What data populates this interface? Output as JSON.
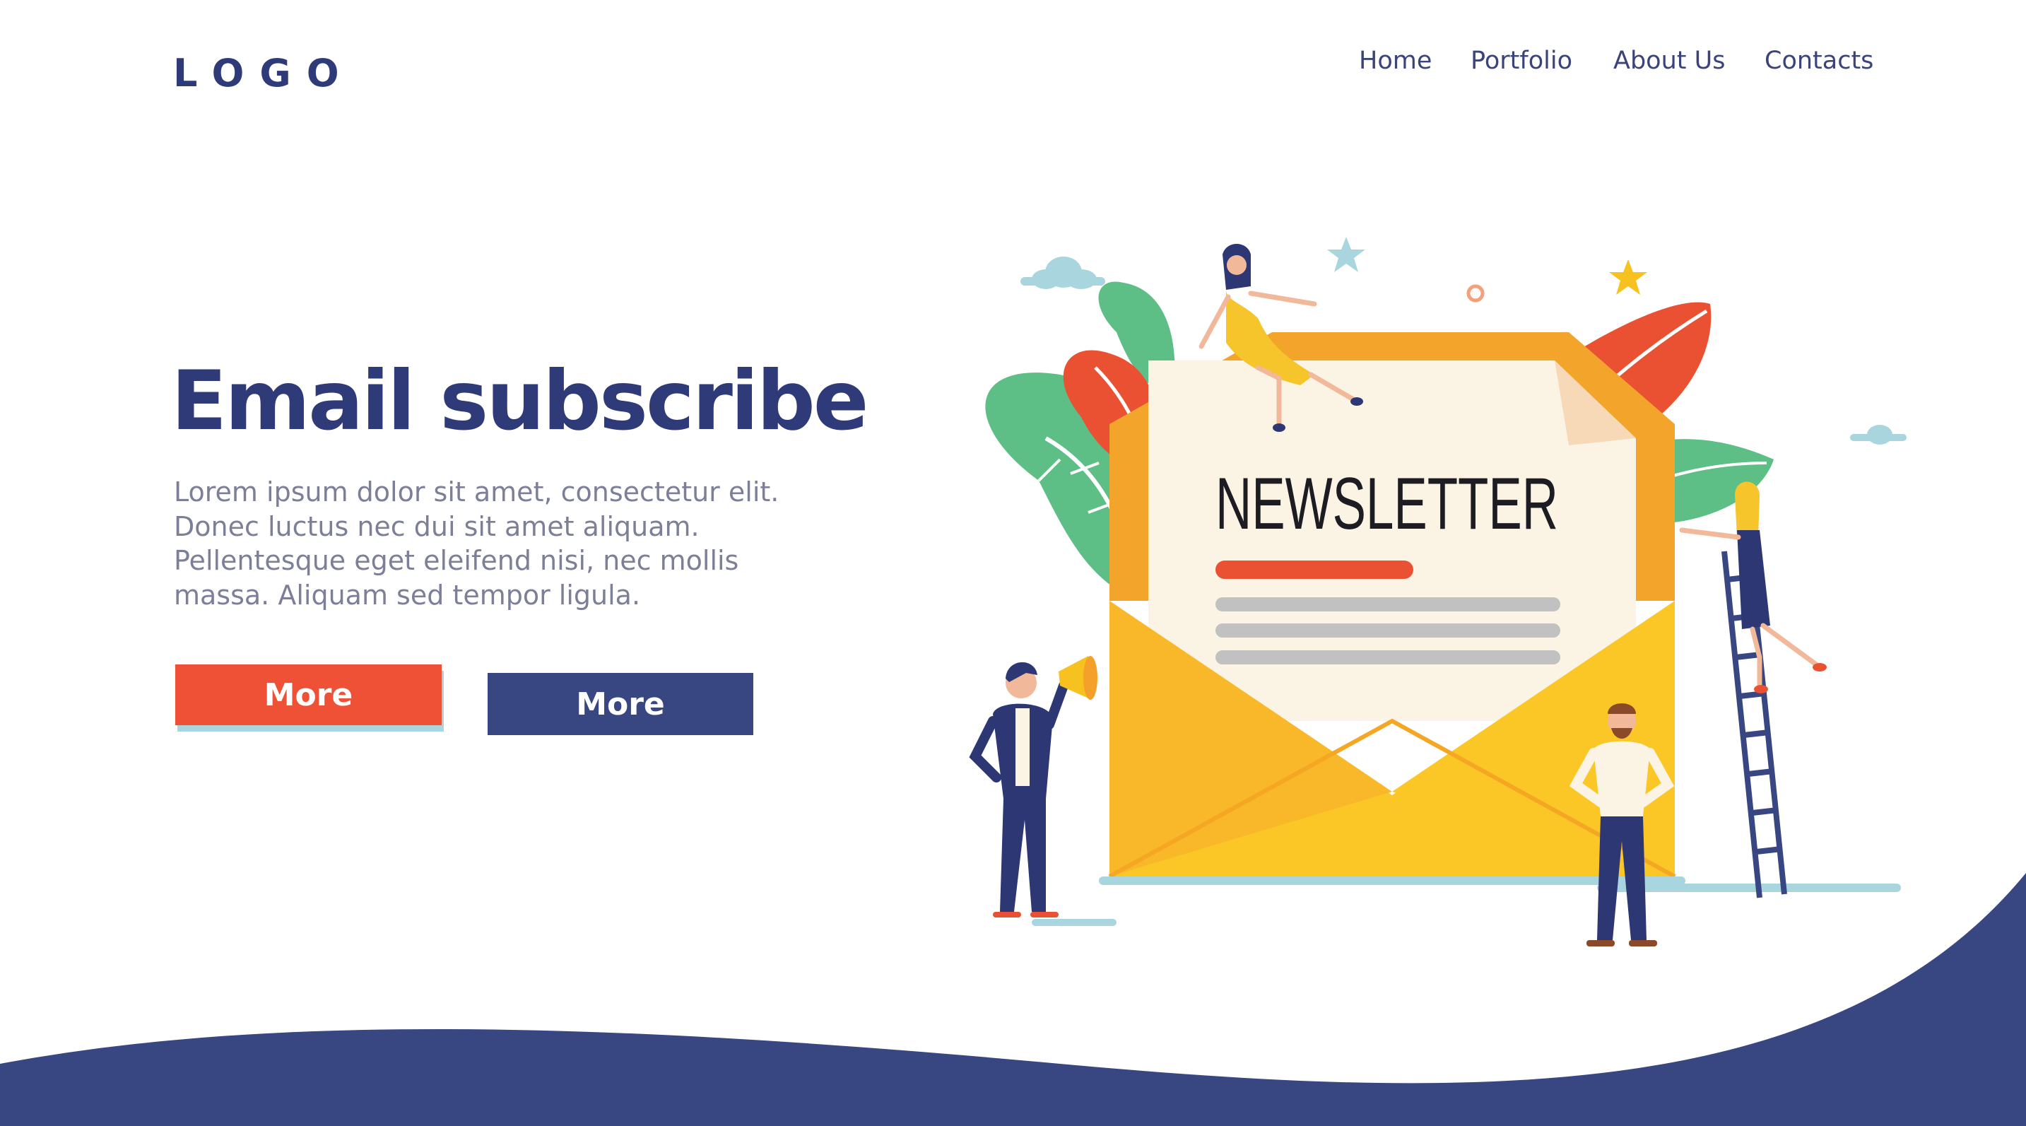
{
  "header": {
    "logo": "LOGO",
    "nav": [
      "Home",
      "Portfolio",
      "About Us",
      "Contacts"
    ]
  },
  "hero": {
    "title": "Email subscribe",
    "text": "Lorem ipsum dolor sit amet, consectetur elit. Donec luctus nec dui sit amet aliquam. Pellentesque eget eleifend nisi, nec mollis massa. Aliquam sed tempor ligula.",
    "buttons": [
      "More",
      "More"
    ]
  },
  "illustration": {
    "paper_heading": "NEWSLETTER"
  },
  "colors": {
    "navy": "#384682",
    "accent_red": "#ef5137",
    "envelope_yellow": "#fbc727",
    "leaf_green": "#5dbf86"
  },
  "icons": [
    "cloud-icon",
    "star-icon",
    "megaphone-icon",
    "ladder-icon",
    "envelope-icon"
  ]
}
